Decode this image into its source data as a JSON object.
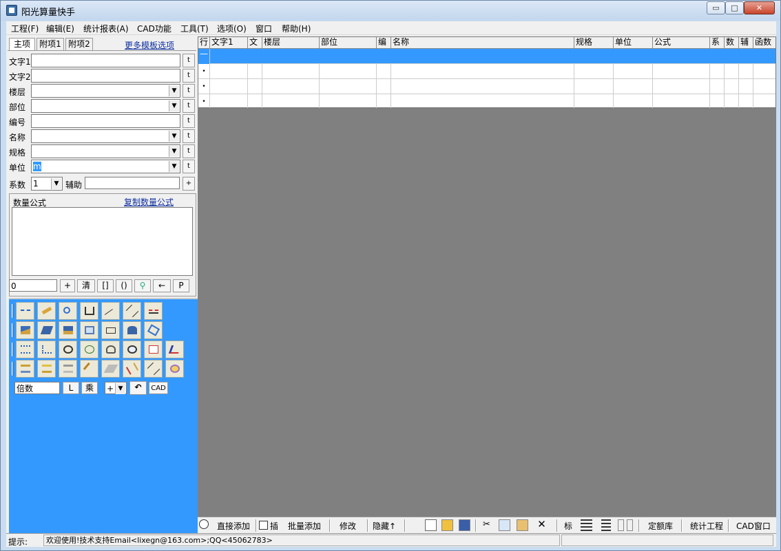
{
  "window": {
    "title": "阳光算量快手",
    "min": "▭",
    "max": "□",
    "close": "✕"
  },
  "menu": [
    "工程(F)",
    "编辑(E)",
    "统计报表(A)",
    "CAD功能",
    "工具(T)",
    "选项(O)",
    "窗口",
    "帮助(H)"
  ],
  "tabs": [
    "主项",
    "附项1",
    "附项2"
  ],
  "more_templates": "更多模板选项",
  "fields": {
    "text1": {
      "label": "文字1",
      "value": ""
    },
    "text2": {
      "label": "文字2",
      "value": ""
    },
    "floor": {
      "label": "楼层",
      "value": ""
    },
    "part": {
      "label": "部位",
      "value": ""
    },
    "code": {
      "label": "编号",
      "value": ""
    },
    "name": {
      "label": "名称",
      "value": ""
    },
    "spec": {
      "label": "规格",
      "value": ""
    },
    "unit": {
      "label": "单位",
      "value": "m"
    },
    "coef": {
      "label": "系数",
      "value": "1"
    },
    "aux": {
      "label": "辅助",
      "value": ""
    }
  },
  "t_button": "t",
  "plus_button": "+",
  "formula": {
    "label": "数量公式",
    "copy_link": "复制数量公式",
    "value": "0"
  },
  "calc_buttons": [
    "+",
    "清",
    "[]",
    "()",
    "←",
    "P"
  ],
  "multiplier": {
    "value": "倍数",
    "l_button": "L",
    "mult_button": "乘",
    "op": "+",
    "cad": "CAD"
  },
  "grid": {
    "columns": [
      "行",
      "文字1",
      "文",
      "楼层",
      "部位",
      "编",
      "名称",
      "规格",
      "单位",
      "公式",
      "系",
      "数",
      "辅",
      "函数"
    ],
    "rows": [
      "—",
      "•",
      "•",
      "•"
    ]
  },
  "bottombar": {
    "direct_add": "直接添加",
    "insert": "插",
    "batch_add": "批量添加",
    "modify": "修改",
    "hide": "隐藏↑",
    "mark": "标",
    "quota": "定额库",
    "stats": "统计工程",
    "cad_window": "CAD窗口"
  },
  "status": {
    "label": "提示:",
    "message": "欢迎使用!技术支持Email<lixegn@163.com>;QQ<45062783>"
  },
  "colors": {
    "accent_blue": "#3399ff",
    "selected_row": "#3399ff",
    "workspace_gray": "#808080"
  }
}
